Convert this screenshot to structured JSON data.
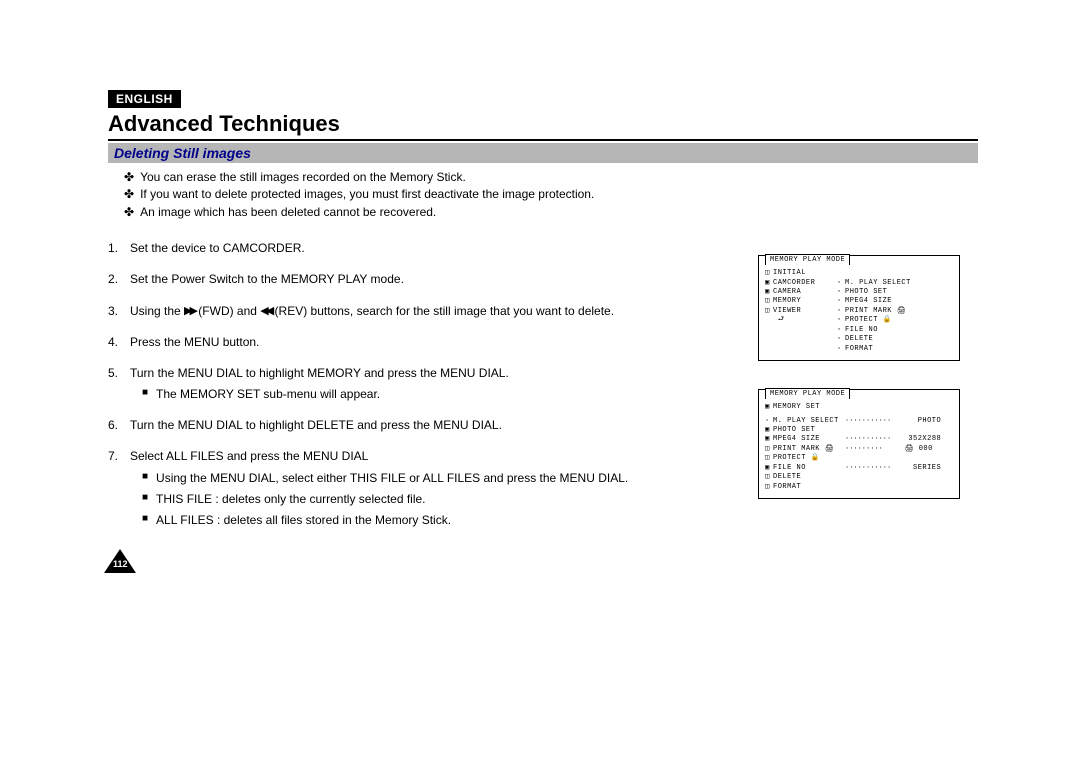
{
  "language_badge": "ENGLISH",
  "title": "Advanced Techniques",
  "subtitle": "Deleting Still images",
  "intro": [
    "You can erase the still images recorded on the Memory Stick.",
    "If you want to delete protected images, you must first deactivate the image protection.",
    "An image which has been deleted cannot be recovered."
  ],
  "steps": {
    "s1": "Set the device to CAMCORDER.",
    "s2": "Set the Power Switch to the MEMORY PLAY mode.",
    "s3a": "Using the ",
    "s3b": " (FWD) and ",
    "s3c": " (REV) buttons, search for the still image that you want to delete.",
    "s4": "Press the MENU button.",
    "s5": "Turn the MENU DIAL to highlight MEMORY and press the MENU DIAL.",
    "s5sub": "The MEMORY SET sub-menu will appear.",
    "s6": "Turn the MENU DIAL to highlight DELETE and press the MENU DIAL.",
    "s7": "Select ALL FILES and press the MENU DIAL",
    "s7sub1": "Using the MENU DIAL, select either THIS FILE or ALL FILES and press the MENU DIAL.",
    "s7sub2": "THIS FILE : deletes only the currently selected file.",
    "s7sub3": "ALL FILES : deletes all files stored in the Memory Stick."
  },
  "lcd1": {
    "tab": "MEMORY PLAY MODE",
    "left": [
      "INITIAL",
      "CAMCORDER",
      "CAMERA",
      "MEMORY",
      "VIEWER"
    ],
    "right": [
      "M. PLAY SELECT",
      "PHOTO SET",
      "MPEG4 SIZE",
      "PRINT MARK",
      "PROTECT",
      "FILE NO",
      "DELETE",
      "FORMAT"
    ]
  },
  "lcd2": {
    "tab": "MEMORY PLAY MODE",
    "heading": "MEMORY SET",
    "items": [
      {
        "label": "M. PLAY SELECT",
        "value": "PHOTO"
      },
      {
        "label": "PHOTO SET",
        "value": ""
      },
      {
        "label": "MPEG4 SIZE",
        "value": "352X288"
      },
      {
        "label": "PRINT MARK",
        "value": "000"
      },
      {
        "label": "PROTECT",
        "value": ""
      },
      {
        "label": "FILE NO",
        "value": "SERIES"
      },
      {
        "label": "DELETE",
        "value": ""
      },
      {
        "label": "FORMAT",
        "value": ""
      }
    ]
  },
  "page_number": "112"
}
